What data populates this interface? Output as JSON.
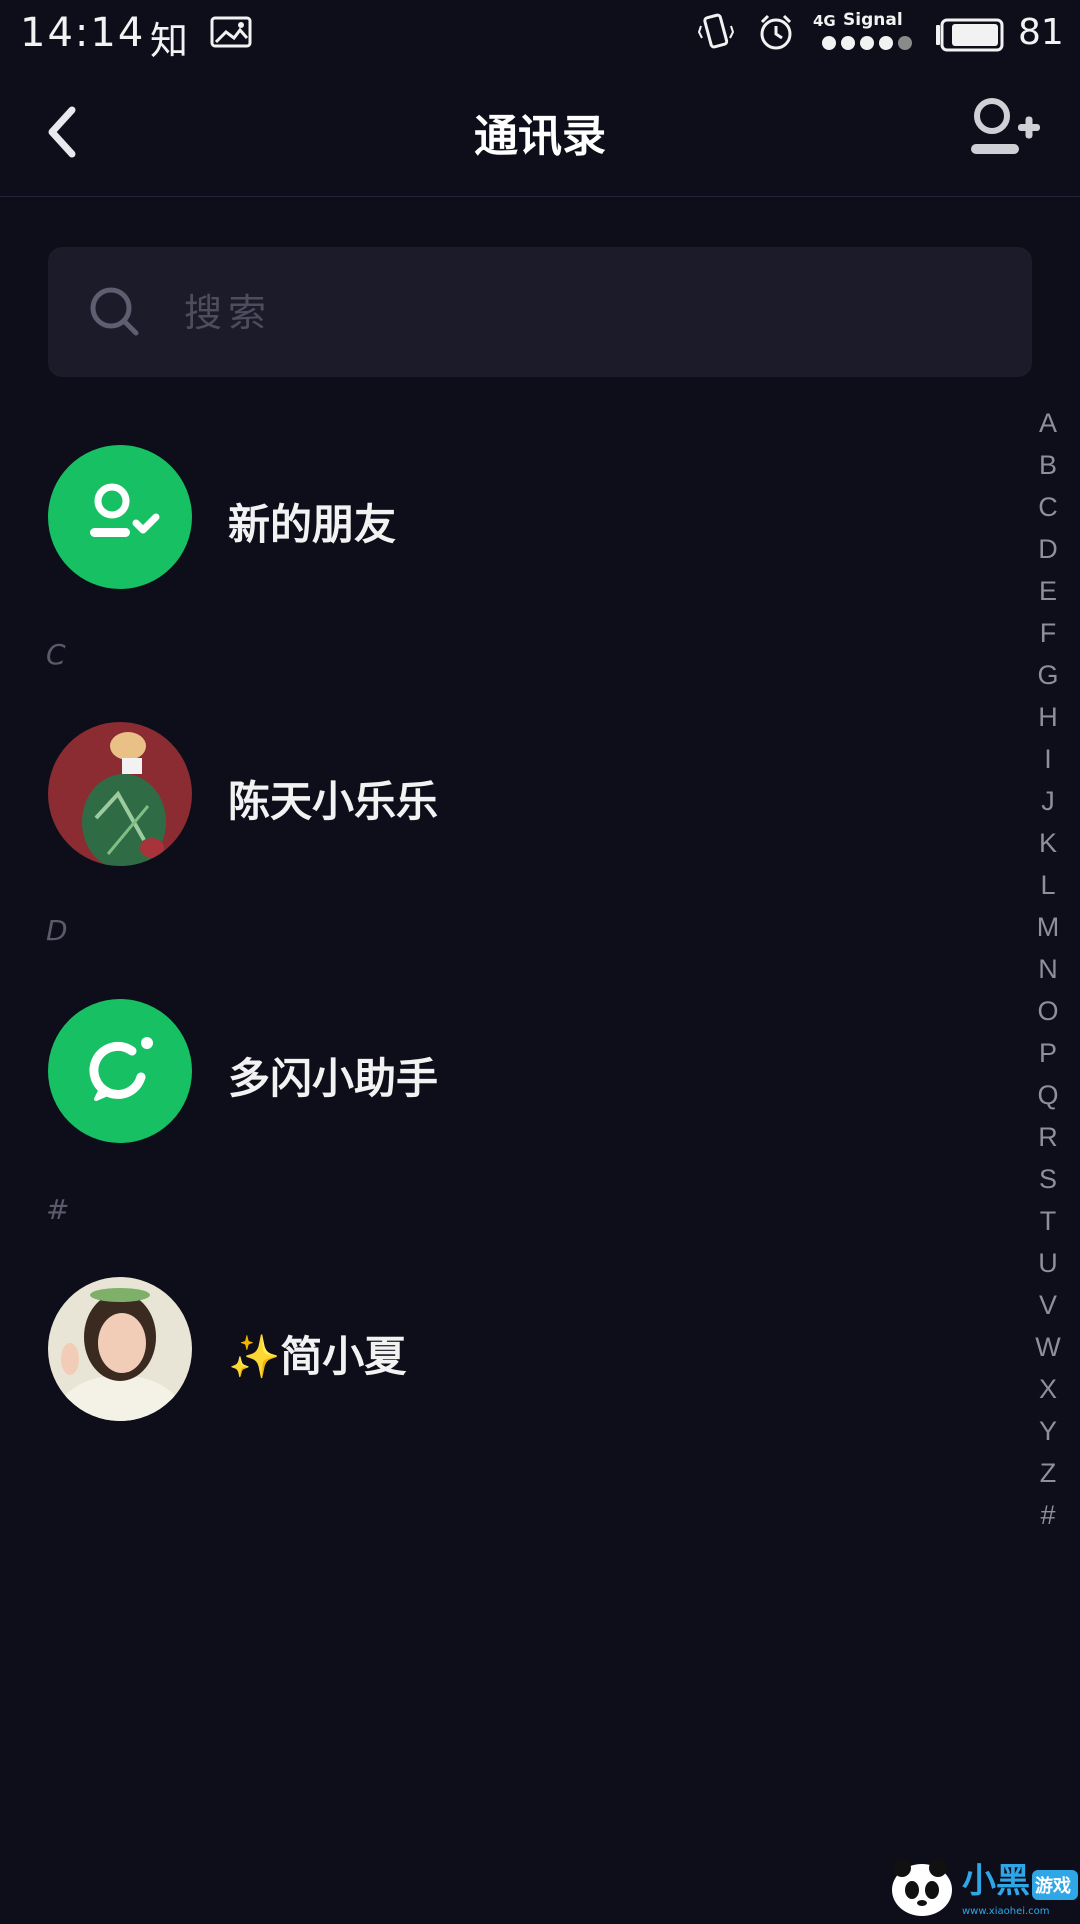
{
  "status_bar": {
    "time": "14:14",
    "app_label": "知",
    "network": "4G",
    "signal_label": "Signal",
    "battery_level": "81"
  },
  "header": {
    "title": "通讯录",
    "back_icon": "chevron-left-icon",
    "add_icon": "add-friend-icon"
  },
  "search": {
    "placeholder": "搜索"
  },
  "new_friends": {
    "label": "新的朋友"
  },
  "sections": [
    {
      "letter": "C",
      "contacts": [
        {
          "name": "陈天小乐乐"
        }
      ]
    },
    {
      "letter": "D",
      "contacts": [
        {
          "name": "多闪小助手"
        }
      ]
    },
    {
      "letter": "#",
      "contacts": [
        {
          "name": "✨简小夏"
        }
      ]
    }
  ],
  "alphabet_index": [
    "A",
    "B",
    "C",
    "D",
    "E",
    "F",
    "G",
    "H",
    "I",
    "J",
    "K",
    "L",
    "M",
    "N",
    "O",
    "P",
    "Q",
    "R",
    "S",
    "T",
    "U",
    "V",
    "W",
    "X",
    "Y",
    "Z",
    "#"
  ],
  "watermark": {
    "text": "小黑游戏",
    "url_text": "www.xiaohei.com"
  },
  "colors": {
    "background": "#0e0e1a",
    "accent_green": "#17c063",
    "search_bg": "#1b1b29"
  }
}
